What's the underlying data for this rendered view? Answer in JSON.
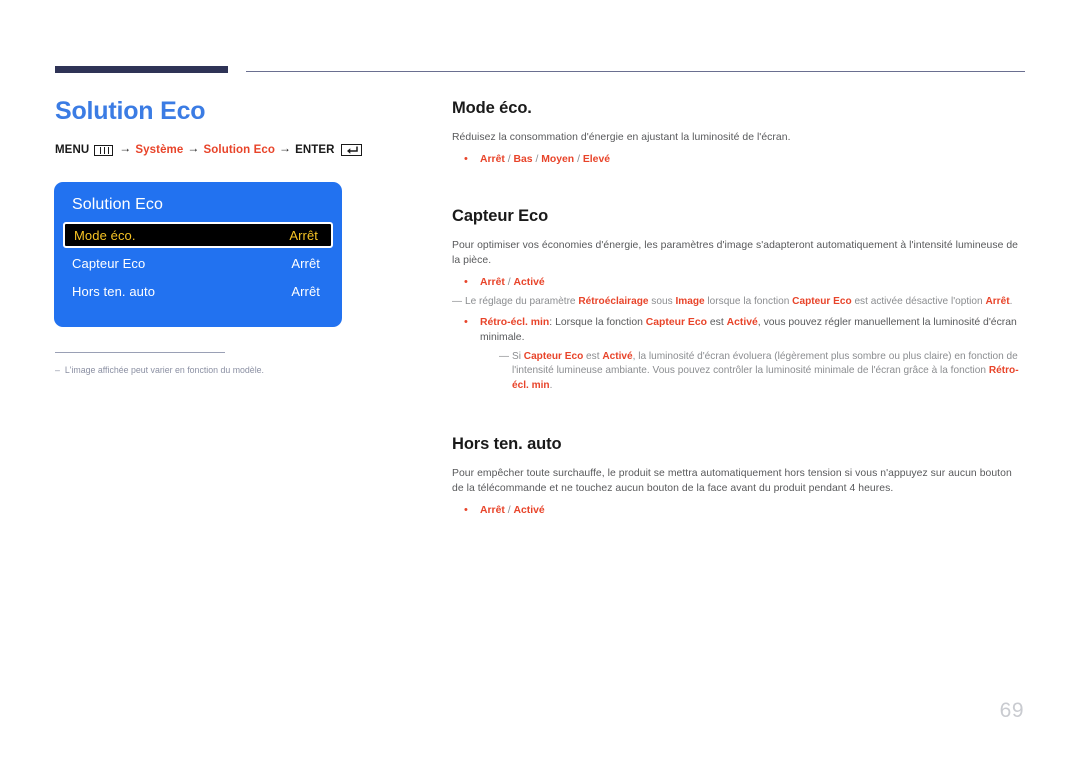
{
  "page": {
    "number": "69",
    "title": "Solution Eco"
  },
  "menu_path": {
    "menu_label": "MENU",
    "menu_icon": "menu-grid-icon",
    "arrow": "→",
    "step1": "Système",
    "step2": "Solution Eco",
    "enter_label": "ENTER",
    "enter_icon": "enter-return-icon"
  },
  "osd": {
    "title": "Solution Eco",
    "rows": [
      {
        "label": "Mode éco.",
        "value": "Arrêt",
        "selected": true
      },
      {
        "label": "Capteur Eco",
        "value": "Arrêt",
        "selected": false
      },
      {
        "label": "Hors ten. auto",
        "value": "Arrêt",
        "selected": false
      }
    ]
  },
  "left_note": {
    "dash": "–",
    "text": "L'image affichée peut varier en fonction du modèle."
  },
  "sections": {
    "mode_eco": {
      "heading": "Mode éco.",
      "body": "Réduisez la consommation d'énergie en ajustant la luminosité de l'écran.",
      "bullet_dot": "•",
      "options": [
        "Arrêt",
        "Bas",
        "Moyen",
        "Elevé"
      ],
      "option_sep": "/"
    },
    "capteur_eco": {
      "heading": "Capteur Eco",
      "body": "Pour optimiser vos économies d'énergie, les paramètres d'image s'adapteront automatiquement à l'intensité lumineuse de la pièce.",
      "bullet_dot": "•",
      "options": [
        "Arrêt",
        "Activé"
      ],
      "option_sep": "/",
      "note1": {
        "dash": "—",
        "part1": "Le réglage du paramètre ",
        "hl1": "Rétroéclairage",
        "part2": " sous ",
        "hl2": "Image",
        "part3": " lorsque la fonction ",
        "hl3": "Capteur Eco",
        "part4": " est activée désactive l'option ",
        "hl4": "Arrêt",
        "part5": "."
      },
      "bullet2": {
        "dot": "•",
        "hl1": "Rétro-écl. min",
        "part1": ": Lorsque la fonction ",
        "hl2": "Capteur Eco",
        "part2": " est ",
        "hl3": "Activé",
        "part3": ", vous pouvez régler manuellement la luminosité d'écran minimale."
      },
      "note2": {
        "dash": "—",
        "part1": "Si ",
        "hl1": "Capteur Eco",
        "part2": " est ",
        "hl2": "Activé",
        "part3": ", la luminosité d'écran évoluera (légèrement plus sombre ou plus claire) en fonction de l'intensité lumineuse ambiante. Vous pouvez contrôler la luminosité minimale de l'écran grâce à la fonction ",
        "hl3": "Rétro-écl. min",
        "part4": "."
      }
    },
    "hors_ten_auto": {
      "heading": "Hors ten. auto",
      "body": "Pour empêcher toute surchauffe, le produit se mettra automatiquement hors tension si vous n'appuyez sur aucun bouton de la télécommande et ne touchez aucun bouton de la face avant du produit pendant 4 heures.",
      "bullet_dot": "•",
      "options": [
        "Arrêt",
        "Activé"
      ],
      "option_sep": "/"
    }
  },
  "colors": {
    "accent_blue": "#3b7ce4",
    "accent_orange": "#e8442a",
    "osd_blue": "#2272f0",
    "osd_highlight_text": "#f6c324",
    "rule_navy": "#2e3356"
  }
}
